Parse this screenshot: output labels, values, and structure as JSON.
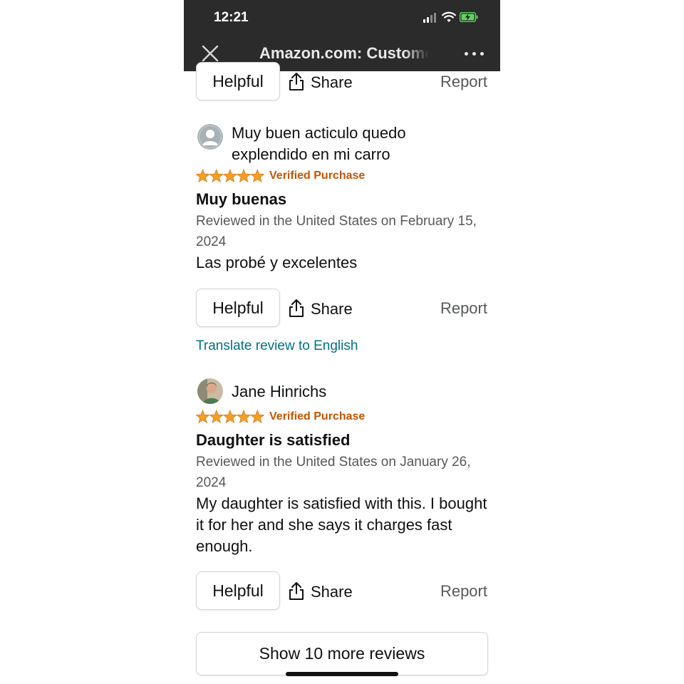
{
  "status_bar": {
    "time": "12:21"
  },
  "nav": {
    "title": "Amazon.com: Customer Reviews"
  },
  "colors": {
    "star": "#f0a125",
    "verified": "#c45500",
    "link": "#007185",
    "bar": "#2b2b2b"
  },
  "actions": {
    "helpful": "Helpful",
    "share": "Share",
    "report": "Report"
  },
  "reviews": [
    {
      "reviewer": "Muy buen acticulo quedo explendido en mi carro",
      "rating": 5,
      "verified": "Verified Purchase",
      "title": "Muy buenas",
      "date": "Reviewed in the United States on February 15, 2024",
      "body": "Las probé y excelentes",
      "translate": "Translate review to English"
    },
    {
      "reviewer": "Jane Hinrichs",
      "rating": 5,
      "verified": "Verified Purchase",
      "title": "Daughter is satisfied",
      "date": "Reviewed in the United States on January 26, 2024",
      "body": "My daughter is satisfied with this. I bought it for her and she says it charges fast enough."
    }
  ],
  "show_more": "Show 10 more reviews"
}
